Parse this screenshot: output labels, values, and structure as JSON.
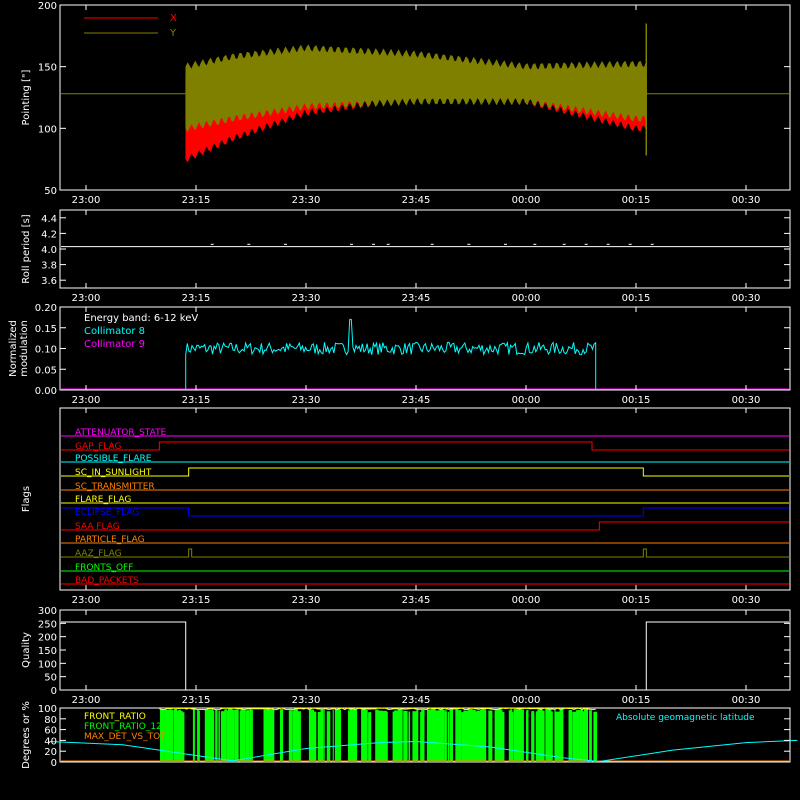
{
  "colors": {
    "axis": "#ffffff",
    "x_series": "#ff0000",
    "y_series": "#808000",
    "collimator8": "#00ffff",
    "collimator9": "#ff00ff",
    "quality": "#ffffff",
    "front_ratio": "#ffff00",
    "front_ratio_1225": "#00ff00",
    "max_det": "#ff8000",
    "geomag": "#00ffff"
  },
  "time_ticks": [
    "23:00",
    "23:15",
    "23:30",
    "23:45",
    "00:00",
    "00:15",
    "00:30"
  ],
  "chart_data": [
    {
      "id": "pointing",
      "type": "line",
      "ylabel": "Pointing [\"]",
      "ylim": [
        50,
        200
      ],
      "yticks": [
        50,
        100,
        150,
        200
      ],
      "legend_placement": "top-left",
      "series": [
        {
          "name": "X",
          "color": "#ff0000",
          "baseline": 128,
          "start": "23:13.6",
          "end": "00:16.4",
          "envelope": [
            [
              "23:13.6",
              75,
              142
            ],
            [
              "23:20",
              92,
              150
            ],
            [
              "23:30",
              113,
              155
            ],
            [
              "23:45",
              125,
              150
            ],
            [
              "00:00",
              122,
              145
            ],
            [
              "00:15",
              100,
              148
            ]
          ]
        },
        {
          "name": "Y",
          "color": "#808000",
          "baseline": 128,
          "start": "23:13.6",
          "end": "00:16.4",
          "envelope": [
            [
              "23:13.6",
              100,
              150
            ],
            [
              "23:20",
              108,
              158
            ],
            [
              "23:30",
              118,
              165
            ],
            [
              "23:45",
              122,
              160
            ],
            [
              "00:00",
              122,
              150
            ],
            [
              "00:15",
              108,
              152
            ]
          ]
        }
      ]
    },
    {
      "id": "roll_period",
      "type": "line",
      "ylabel": "Roll period [s]",
      "ylim": [
        3.5,
        4.5
      ],
      "yticks": [
        3.6,
        3.8,
        4.0,
        4.2,
        4.4
      ],
      "series": [
        {
          "name": "",
          "color": "#ffffff",
          "values_constant": 4.03,
          "blips": 4.06
        }
      ]
    },
    {
      "id": "modulation",
      "type": "line",
      "ylabel": "Normalized modulation",
      "ylim": [
        0,
        0.2
      ],
      "yticks": [
        "0.00",
        "0.05",
        "0.10",
        "0.15",
        "0.20"
      ],
      "annotation": "Energy band: 6-12 keV",
      "series": [
        {
          "name": "Collimator 8",
          "color": "#00ffff",
          "start": "23:13.6",
          "end": "00:09.5",
          "mean": 0.1,
          "noise": 0.015,
          "spike": [
            [
              "23:36",
              0.17
            ]
          ]
        },
        {
          "name": "Collimator 9",
          "color": "#ff00ff",
          "values_constant": 0.0
        }
      ]
    },
    {
      "id": "flags",
      "type": "line",
      "ylabel": "Flags",
      "flags": [
        {
          "name": "ATTENUATOR_STATE",
          "color": "#ff00ff",
          "changes": []
        },
        {
          "name": "SAA_FLAG",
          "color": "#ff0000",
          "changes": [
            [
              "23:10",
              "up"
            ],
            [
              "00:09",
              "down"
            ]
          ],
          "displayed_name": "GAP_FLAG"
        },
        {
          "name": "POSSIBLE_FLARE",
          "color": "#00ffff",
          "changes": []
        },
        {
          "name": "SC_IN_SUNLIGHT",
          "color": "#ffff00",
          "changes": [
            [
              "23:14",
              "up"
            ],
            [
              "00:16",
              "down"
            ]
          ]
        },
        {
          "name": "SC_TRANSMITTER",
          "color": "#ff8000",
          "changes": []
        },
        {
          "name": "FLARE_FLAG",
          "color": "#ffff00",
          "changes": []
        },
        {
          "name": "ECLIPSE_FLAG",
          "color": "#0000ff",
          "changes": [
            [
              "23:14",
              "down"
            ],
            [
              "00:16",
              "up"
            ]
          ]
        },
        {
          "name": "SAA_FLAG_2",
          "color": "#ff0000",
          "changes": [
            [
              "00:10",
              "up"
            ]
          ],
          "displayed_name": "SAA FLAG"
        },
        {
          "name": "PARTICLE_FLAG",
          "color": "#ff8000",
          "changes": []
        },
        {
          "name": "AAZ_FLAG",
          "color": "#808000",
          "changes": [
            [
              "23:14",
              "pulse"
            ],
            [
              "00:16",
              "pulse"
            ]
          ]
        },
        {
          "name": "FRONTS_OFF",
          "color": "#00ff00",
          "changes": []
        },
        {
          "name": "BAD_PACKETS",
          "color": "#ff0000",
          "changes": []
        }
      ]
    },
    {
      "id": "quality",
      "type": "line",
      "ylabel": "Quality",
      "ylim": [
        0,
        300
      ],
      "yticks": [
        0,
        50,
        100,
        150,
        200,
        250,
        300
      ],
      "series": [
        {
          "name": "",
          "color": "#ffffff",
          "segments": [
            [
              "22:55",
              "23:13.6",
              255
            ],
            [
              "23:13.6",
              "00:16.4",
              0
            ],
            [
              "00:16.4",
              "00:37",
              255
            ]
          ]
        }
      ]
    },
    {
      "id": "ratios",
      "type": "line",
      "ylabel": "Degrees or %",
      "ylim": [
        0,
        100
      ],
      "yticks": [
        0,
        20,
        40,
        60,
        80,
        100
      ],
      "series": [
        {
          "name": "FRONT_RATIO",
          "color": "#ffff00"
        },
        {
          "name": "FRONT_RATIO_1225",
          "color": "#00ff00"
        },
        {
          "name": "MAX_DET_VS_TOT",
          "color": "#ff8000"
        },
        {
          "name": "Absolute geomagnetic latitude",
          "color": "#00ffff"
        }
      ],
      "geomag": [
        [
          "22:55",
          38
        ],
        [
          "23:05",
          32
        ],
        [
          "23:15",
          12
        ],
        [
          "23:20",
          2
        ],
        [
          "23:30",
          25
        ],
        [
          "23:40",
          36
        ],
        [
          "23:45",
          38
        ],
        [
          "23:55",
          28
        ],
        [
          "00:05",
          8
        ],
        [
          "00:10",
          1
        ],
        [
          "00:20",
          22
        ],
        [
          "00:30",
          36
        ],
        [
          "00:37",
          40
        ]
      ]
    }
  ],
  "legend_labels": {
    "pointing_x": "X",
    "pointing_y": "Y",
    "energy_band": "Energy band: 6-12 keV",
    "coll8": "Collimator 8",
    "coll9": "Collimator 9",
    "front_ratio": "FRONT_RATIO",
    "front_ratio_1225": "FRONT_RATIO_1225",
    "max_det": "MAX_DET_VS_TOT",
    "geomag": "Absolute geomagnetic latitude"
  },
  "flag_labels": [
    "ATTENUATOR_STATE",
    "GAP_FLAG",
    "POSSIBLE_FLARE",
    "SC_IN_SUNLIGHT",
    "SC_TRANSMITTER",
    "FLARE_FLAG",
    "ECLIPSE_FLAG",
    "SAA FLAG",
    "PARTICLE_FLAG",
    "AAZ_FLAG",
    "FRONTS_OFF",
    "BAD_PACKETS"
  ]
}
